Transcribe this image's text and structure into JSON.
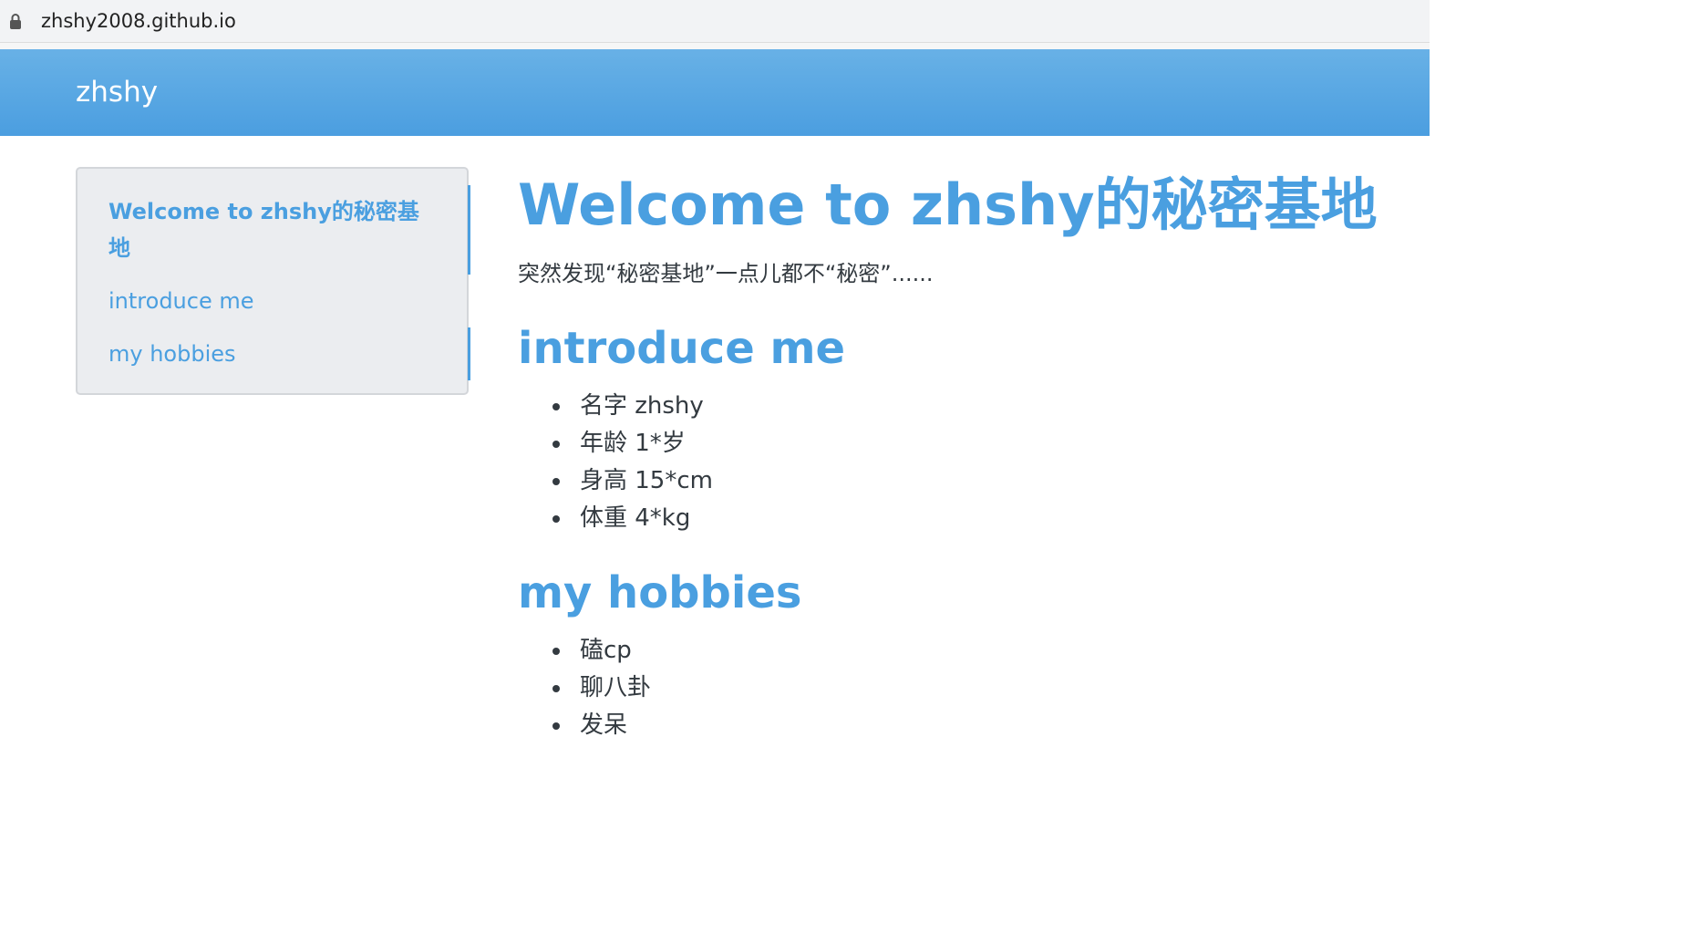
{
  "browser": {
    "url": "zhshy2008.github.io"
  },
  "header": {
    "site_title": "zhshy"
  },
  "toc": {
    "items": [
      {
        "line1": "Welcome to zhshy的秘密基",
        "line2": "地"
      },
      {
        "label": "introduce me"
      },
      {
        "label": "my hobbies"
      }
    ]
  },
  "main": {
    "title": "Welcome to zhshy的秘密基地",
    "subtitle": "突然发现“秘密基地”一点儿都不“秘密”......",
    "sections": [
      {
        "heading": "introduce me",
        "items": [
          "名字 zhshy",
          "年龄 1*岁",
          "身高 15*cm",
          "体重 4*kg"
        ]
      },
      {
        "heading": "my hobbies",
        "items": [
          "磕cp",
          "聊八卦",
          "发呆"
        ]
      }
    ]
  },
  "colors": {
    "accent": "#4a9fe0",
    "text": "#333a40",
    "sidebar_bg": "#ebedf0"
  }
}
